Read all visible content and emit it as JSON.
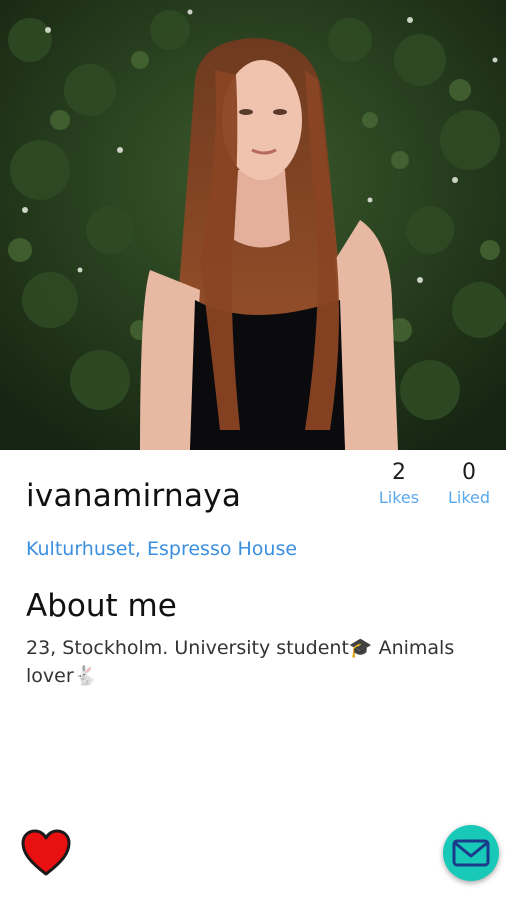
{
  "profile": {
    "username": "ivanamirnaya",
    "location": "Kulturhuset, Espresso House",
    "about_title": "About me",
    "about_text": "23, Stockholm. University student🎓 Animals lover🐇"
  },
  "stats": {
    "likes_count": "2",
    "likes_label": "Likes",
    "liked_count": "0",
    "liked_label": "Liked"
  },
  "actions": {
    "like_icon": "heart-icon",
    "message_icon": "mail-icon"
  },
  "colors": {
    "accent_blue": "#3a8fe0",
    "heart_red": "#e81010",
    "message_teal": "#18c9b8"
  }
}
